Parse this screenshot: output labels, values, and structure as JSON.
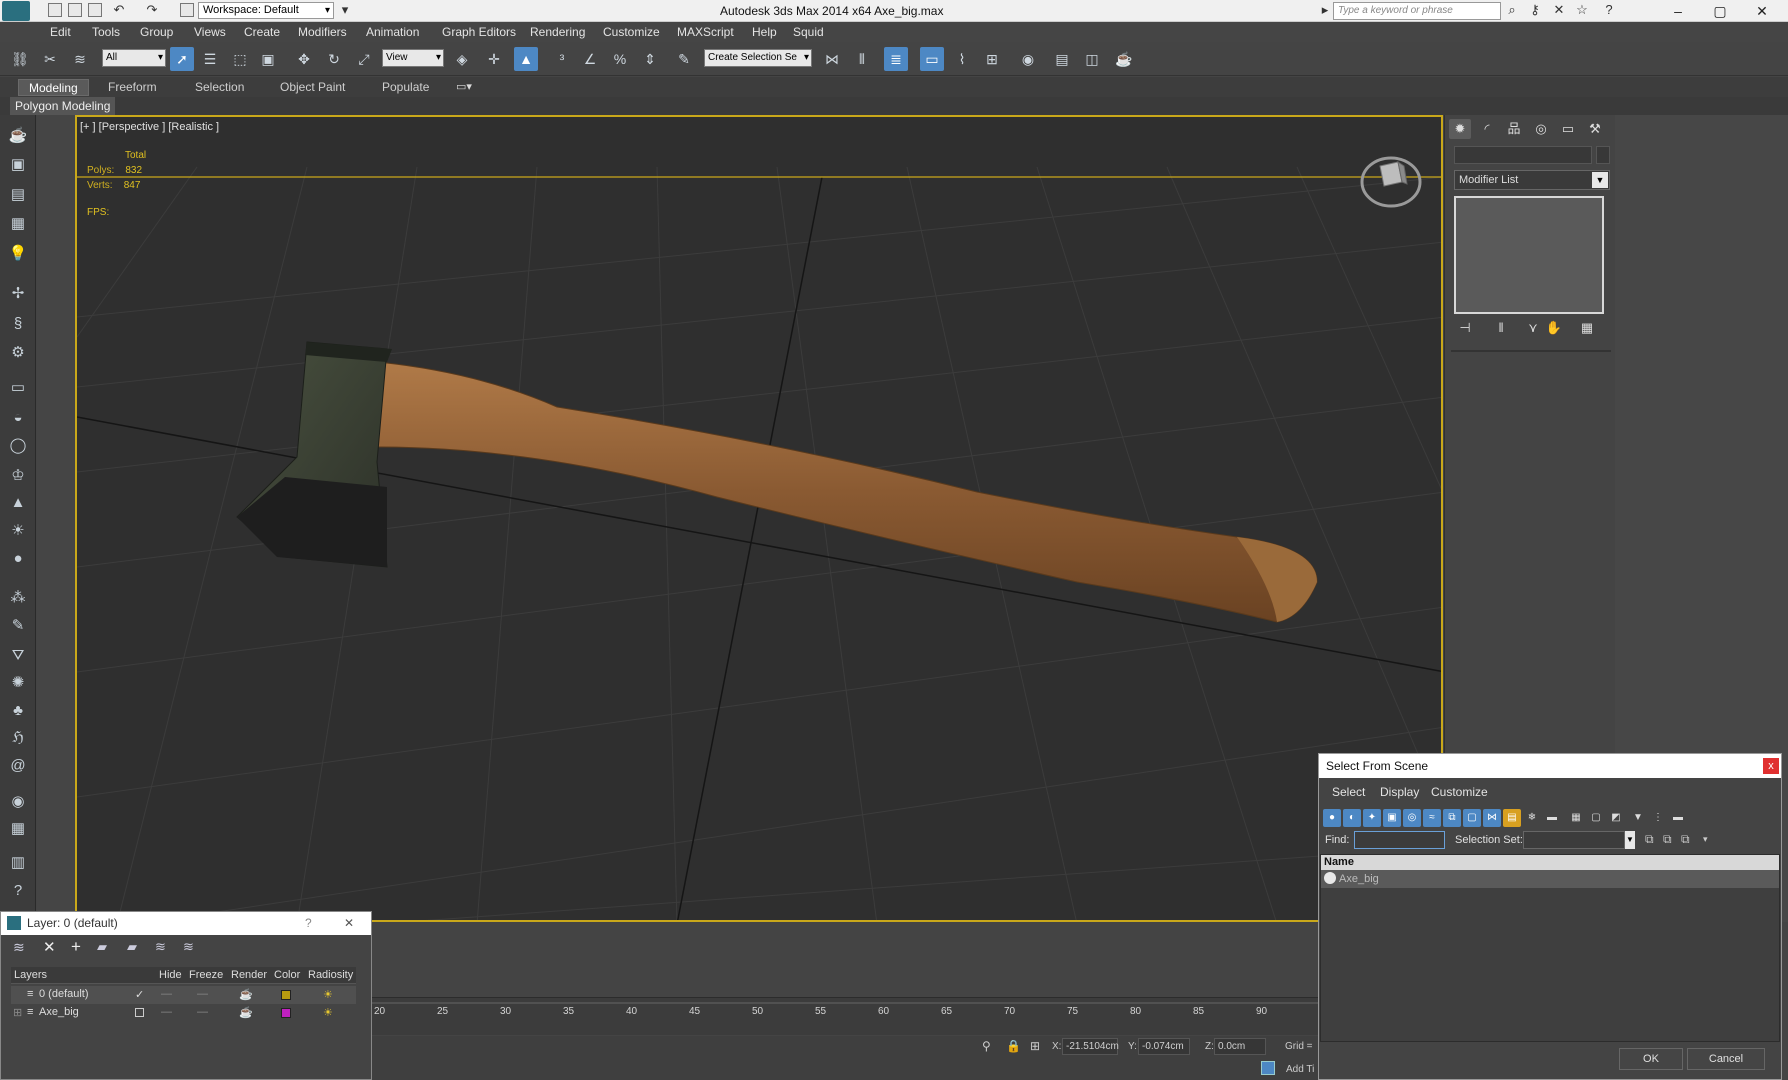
{
  "app": {
    "title": "Autodesk 3ds Max  2014 x64     Axe_big.max",
    "workspace": "Workspace: Default",
    "search_placeholder": "Type a keyword or phrase"
  },
  "menu": [
    "Edit",
    "Tools",
    "Group",
    "Views",
    "Create",
    "Modifiers",
    "Animation",
    "Graph Editors",
    "Rendering",
    "Customize",
    "MAXScript",
    "Help",
    "Squid"
  ],
  "toolbar": {
    "filter": "All",
    "ref_coord": "View",
    "named_selection": "Create Selection Se"
  },
  "ribbon": {
    "tabs": [
      "Modeling",
      "Freeform",
      "Selection",
      "Object Paint",
      "Populate"
    ],
    "panel": "Polygon Modeling"
  },
  "viewport": {
    "label": "[+ ] [Perspective ] [Realistic ]",
    "stats": {
      "total_label": "Total",
      "polys_label": "Polys:",
      "polys": "832",
      "verts_label": "Verts:",
      "verts": "847",
      "fps_label": "FPS:"
    }
  },
  "command_panel": {
    "modifier_list": "Modifier List"
  },
  "timeline": {
    "ticks": [
      "20",
      "25",
      "30",
      "35",
      "40",
      "45",
      "50",
      "55",
      "60",
      "65",
      "70",
      "75",
      "80",
      "85",
      "90"
    ]
  },
  "status": {
    "x_label": "X:",
    "x_value": "-21.5104cm",
    "y_label": "Y:",
    "y_value": "-0.074cm",
    "z_label": "Z:",
    "z_value": "0.0cm",
    "grid_label": "Grid =",
    "add_time_tag": "Add Ti"
  },
  "layer_dialog": {
    "title": "Layer: 0 (default)",
    "help": "?",
    "close": "✕",
    "columns": [
      "Layers",
      "Hide",
      "Freeze",
      "Render",
      "Color",
      "Radiosity"
    ],
    "rows": [
      {
        "name": "0 (default)",
        "color": "#b89a10"
      },
      {
        "name": "Axe_big",
        "color": "#c020c0"
      }
    ]
  },
  "select_dialog": {
    "title": "Select From Scene",
    "close": "x",
    "menu": [
      "Select",
      "Display",
      "Customize"
    ],
    "find_label": "Find:",
    "selection_set_label": "Selection Set:",
    "column_name": "Name",
    "items": [
      "Axe_big"
    ],
    "ok": "OK",
    "cancel": "Cancel"
  },
  "colors": {
    "viewport_border": "#c9a81a",
    "active_blue": "#4d88c4",
    "axe_handle": "#8a5a32",
    "axe_head": "#3a4234"
  }
}
